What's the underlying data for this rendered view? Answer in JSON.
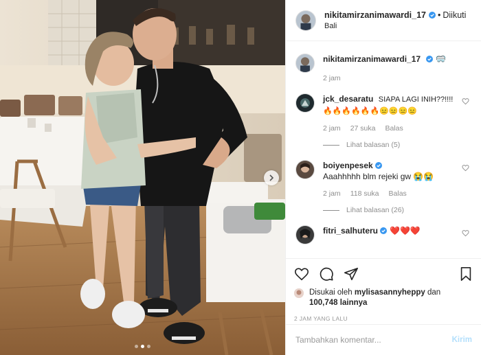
{
  "post": {
    "author": "nikitamirzanimawardi_17",
    "separator": "•",
    "follow_label": "Diikuti",
    "location": "Bali",
    "caption_time": "2 jam",
    "caption_emoji": "🥽"
  },
  "comments": [
    {
      "username": "jck_desaratu",
      "text": "SIAPA LAGI INIH??!!!!🔥🔥🔥🔥🔥🔥😑😑😑😑",
      "time": "2 jam",
      "likes": "27 suka",
      "reply": "Balas",
      "view_replies": "Lihat balasan (5)"
    },
    {
      "username": "boiyenpesek",
      "text": "Aaahhhhh blm rejeki gw 😭😭",
      "time": "2 jam",
      "likes": "118 suka",
      "reply": "Balas",
      "view_replies": "Lihat balasan (26)"
    },
    {
      "username": "fitri_salhuteru",
      "text": "❤️❤️❤️"
    }
  ],
  "likes": {
    "prefix": "Disukai oleh",
    "user": "mylisasannyheppy",
    "connector": "dan",
    "count": "100,748",
    "suffix": "lainnya"
  },
  "timestamp": "2 JAM YANG LALU",
  "comment_box": {
    "placeholder": "Tambahkan komentar...",
    "post_label": "Kirim"
  },
  "colors": {
    "verified": "#3897f0",
    "post_button_disabled": "#b2dffc",
    "heart_red": "#ed4956"
  },
  "carousel": {
    "total": 3,
    "active": 1
  },
  "icons": [
    "next-arrow-icon",
    "verified-badge-icon",
    "heart-icon",
    "comment-icon",
    "share-icon",
    "bookmark-icon"
  ]
}
